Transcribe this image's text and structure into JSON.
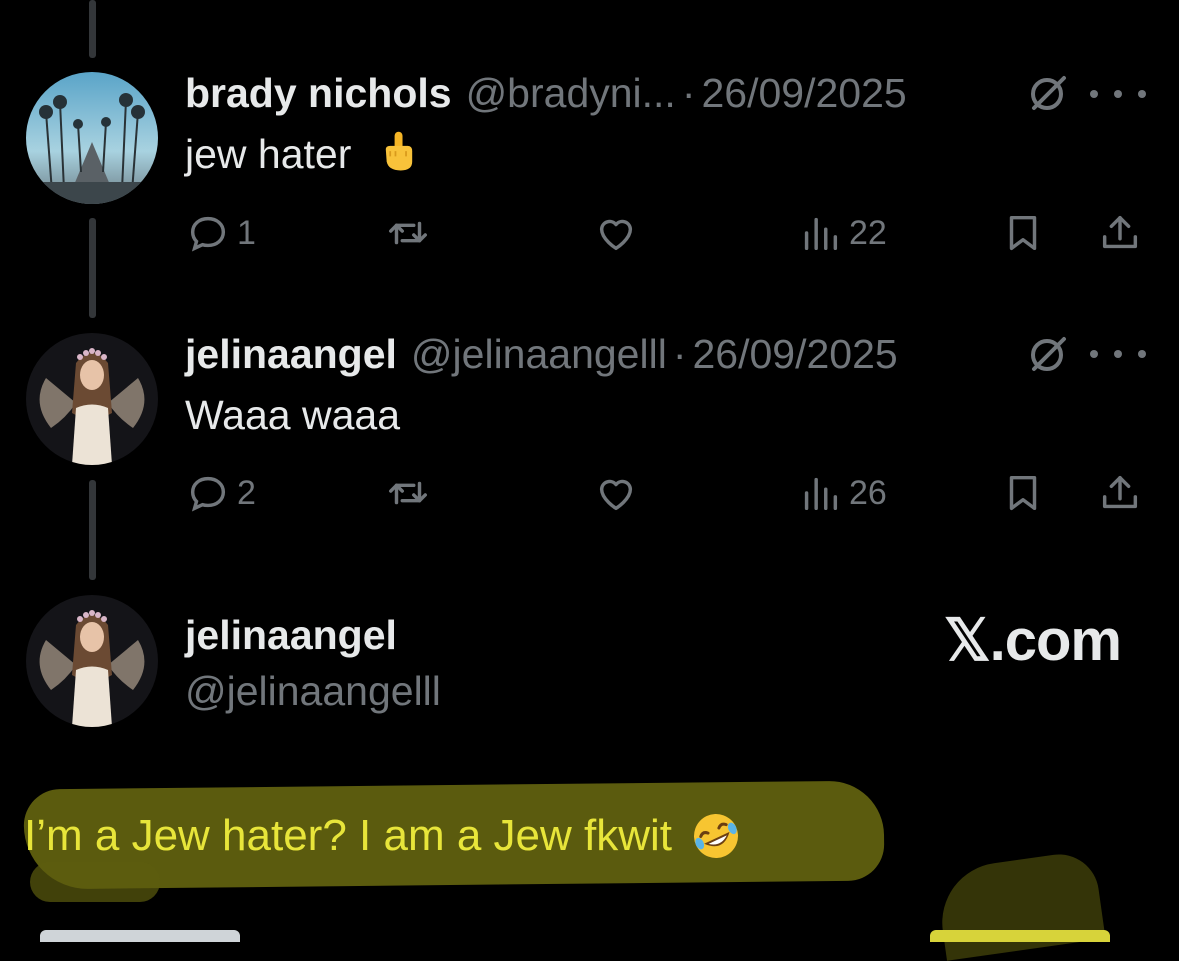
{
  "replies": [
    {
      "name": "brady nichols",
      "handle": "@bradyni...",
      "separator": "·",
      "date": "26/09/2025",
      "text": "jew hater",
      "emoji_icon": "middle-finger-emoji",
      "metrics": {
        "replies": "1",
        "views": "22"
      }
    },
    {
      "name": "jelinaangel",
      "handle": "@jelinaangelll",
      "separator": "·",
      "date": "26/09/2025",
      "text": "Waaa waaa",
      "metrics": {
        "replies": "2",
        "views": "26"
      }
    }
  ],
  "main_post": {
    "name": "jelinaangel",
    "handle": "@jelinaangelll",
    "brand": "𝕏.com",
    "text": "I’m a Jew hater? I am a Jew fkwit",
    "emoji_icon": "rolling-on-floor-laughing-emoji"
  },
  "colors": {
    "background": "#000000",
    "text": "#e7e9ea",
    "muted": "#71767b",
    "highlight_text": "#e8e53a"
  }
}
